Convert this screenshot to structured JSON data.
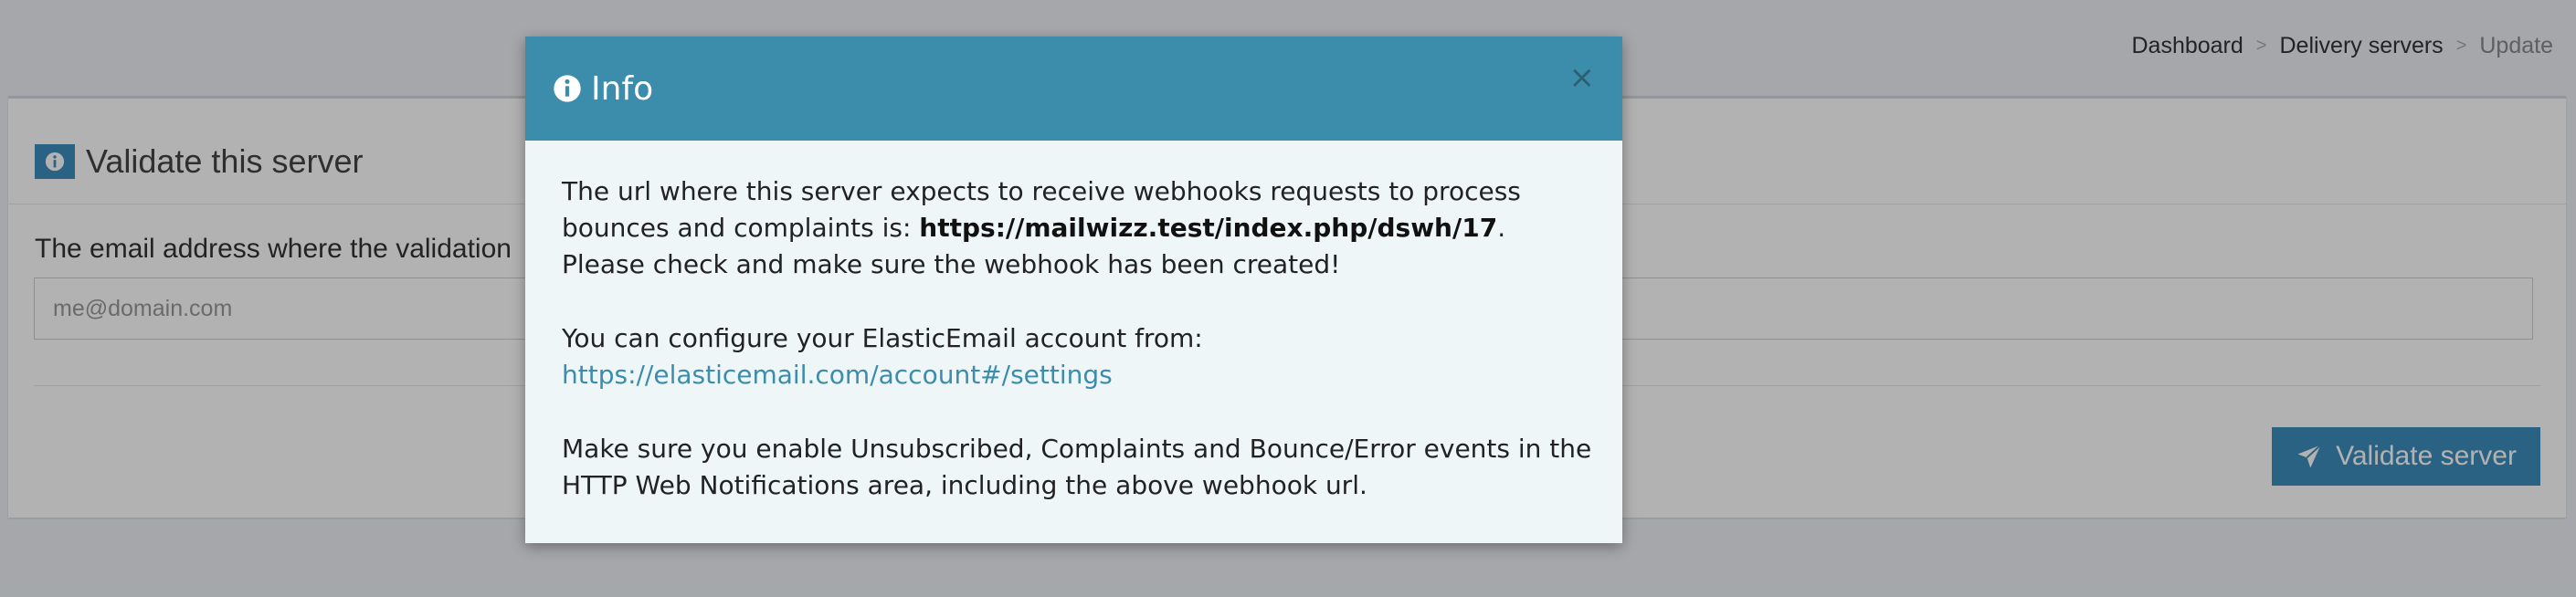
{
  "breadcrumb": {
    "items": [
      "Dashboard",
      "Delivery servers",
      "Update"
    ],
    "separator": ">"
  },
  "box": {
    "title": "Validate this server",
    "field_label": "The email address where the validation",
    "input_placeholder": "me@domain.com",
    "validate_button": "Validate server"
  },
  "modal": {
    "title": "Info",
    "close": "×",
    "p1_prefix": "The url where this server expects to receive webhooks requests to process bounces and complaints is: ",
    "p1_url": "https://mailwizz.test/index.php/dswh/17",
    "p1_suffix": ". Please check and make sure the webhook has been created!",
    "p2_text": "You can configure your ElasticEmail account from:",
    "p2_link": "https://elasticemail.com/account#/settings",
    "p3_text": "Make sure you enable Unsubscribed, Complaints and Bounce/Error events in the HTTP Web Notifications area, including the above webhook url."
  },
  "colors": {
    "primary": "#3c8dbc",
    "modal_header": "#3c8dab",
    "modal_body": "#eef6f8",
    "page_background": "#ecf0f5",
    "close_icon": "#2c5f73"
  },
  "icons": {
    "title_icon": "info-circle-icon",
    "box_title_icon": "info-circle-icon",
    "validate_button_icon": "paper-plane-icon"
  }
}
